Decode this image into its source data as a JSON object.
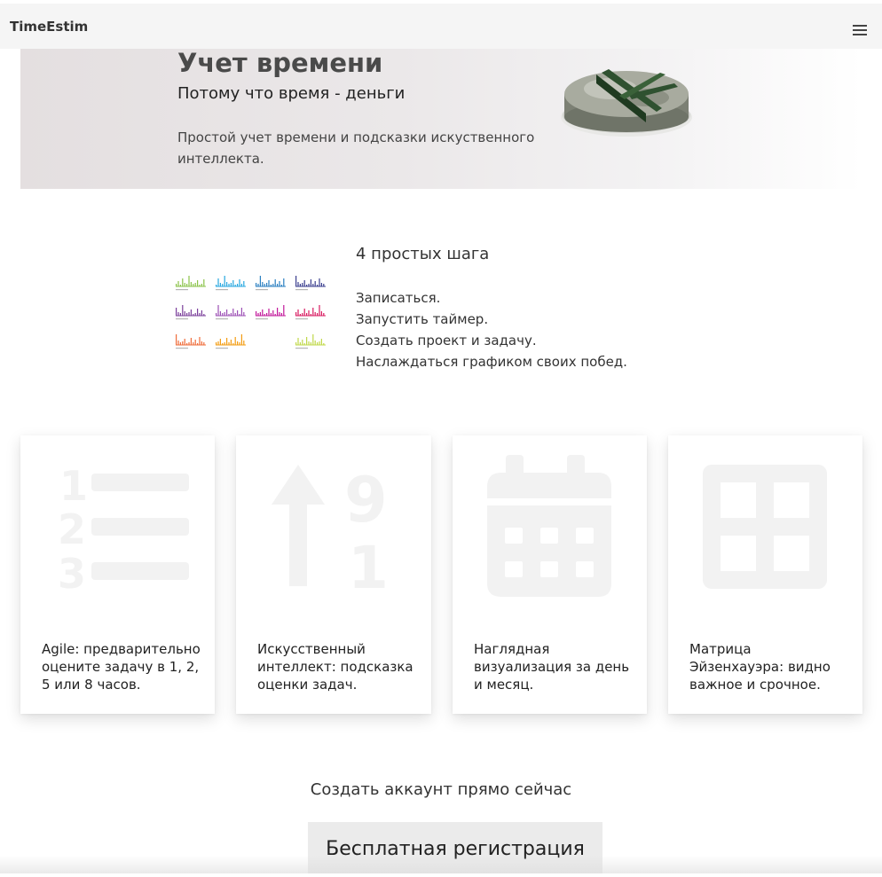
{
  "navbar": {
    "brand": "TimeEstim",
    "menu_icon": "hamburger-menu-icon"
  },
  "hero": {
    "title": "Учет времени",
    "subtitle": "Потому что время - деньги",
    "description": "Простой учет времени и подсказки искуственного интеллекта.",
    "image": "money-pie-chart-image"
  },
  "steps": {
    "image": "small-multiples-charts-image",
    "title": "4 простых шага",
    "items": [
      "Записаться.",
      "Запустить таймер.",
      "Создать проект и задачу.",
      "Наслаждаться графиком своих побед."
    ]
  },
  "features": [
    {
      "icon": "numbered-list-icon",
      "text": "Agile: предварительно оцените задачу в 1, 2, 5 или 8 часов."
    },
    {
      "icon": "sort-numeric-up-icon",
      "text": "Искусственный интеллект: подсказка оценки задач."
    },
    {
      "icon": "calendar-icon",
      "text": "Наглядная визуализация за день и месяц."
    },
    {
      "icon": "grid-matrix-icon",
      "text": "Матрица Эйзенхауэра: видно важное и срочное."
    }
  ],
  "cta": {
    "text": "Создать аккаунт прямо сейчас",
    "button_label": "Бесплатная регистрация"
  },
  "colors": {
    "navbar_bg": "#f5f5f5",
    "icon_gray": "#f2f2f2",
    "button_bg": "#ebebeb"
  }
}
